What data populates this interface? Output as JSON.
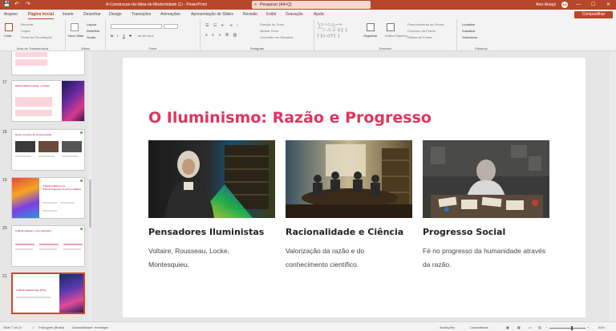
{
  "titlebar": {
    "doc_title": "A-Construcao-da-Ideia-de-Modernidade (1)  -  PowerPoint",
    "search_placeholder": "Pesquisar (Alt+Q)",
    "user_name": "Alex Araujo",
    "user_initials": "AA",
    "save_glyph": "💾",
    "undo_glyph": "↶",
    "redo_glyph": "↷",
    "minimize_glyph": "—",
    "maximize_glyph": "☐",
    "close_glyph": "✕"
  },
  "tabs": [
    "Arquivo",
    "Página Inicial",
    "Inserir",
    "Desenhar",
    "Design",
    "Transições",
    "Animações",
    "Apresentação de Slides",
    "Revisão",
    "Exibir",
    "Gravação",
    "Ajuda"
  ],
  "share_label": "Compartilhar",
  "ribbon": {
    "clipboard": {
      "label": "Área de Transferência",
      "paste": "Colar",
      "cut": "Recortar",
      "copy": "Copiar",
      "format_painter": "Pincel de Formatação"
    },
    "slides": {
      "label": "Slides",
      "new_slide": "Novo Slide",
      "layout": "Layout",
      "reset": "Redefinir",
      "section": "Seção"
    },
    "font": {
      "label": "Fonte",
      "bold": "N",
      "italic": "I",
      "underline": "S",
      "strike": "S",
      "glyphs": "ab  AV  Aa  A"
    },
    "paragraph": {
      "label": "Parágrafo",
      "direction": "Direção do Texto",
      "align": "Alinhar Texto",
      "smartart": "Converter em SmartArt"
    },
    "drawing": {
      "label": "Desenho",
      "arrange": "Organizar",
      "quick_styles": "Estilos Rápidos",
      "fill": "Preenchimento da Forma",
      "outline": "Contorno da Forma",
      "effects": "Efeitos de Forma"
    },
    "editing": {
      "label": "Editando",
      "find": "Localizar",
      "replace": "Substituir",
      "select": "Selecionar"
    }
  },
  "thumbnails": [
    {
      "num": "17",
      "title": "Modernidade Espaço e Tempo"
    },
    {
      "num": "18",
      "title": "Novas Formas de Comunicação"
    },
    {
      "num": "19",
      "title": "A Modernidade e as Transformações na Arte e Cultura"
    },
    {
      "num": "20",
      "title": "A Modernidade e seus Desafios"
    },
    {
      "num": "21",
      "title": "A Modernidade Hoje (Pós)"
    }
  ],
  "slide": {
    "title": "O Iluminismo: Razão e Progresso",
    "cards": [
      {
        "heading": "Pensadores Iluministas",
        "body": "Voltaire, Rousseau, Locke, Montesquieu."
      },
      {
        "heading": "Racionalidade e Ciência",
        "body": "Valorização da razão e do conhecimento científico."
      },
      {
        "heading": "Progresso Social",
        "body": "Fé no progresso da humanidade através da razão."
      }
    ]
  },
  "status": {
    "slide_count": "Slide 7 de 21",
    "language": "Português (Brasil)",
    "accessibility": "Acessibilidade: investigar",
    "notes": "Anotações",
    "comments": "Comentários",
    "zoom": "94%"
  },
  "colors": {
    "accent": "#b7472a",
    "title_pink": "#e0345f"
  }
}
